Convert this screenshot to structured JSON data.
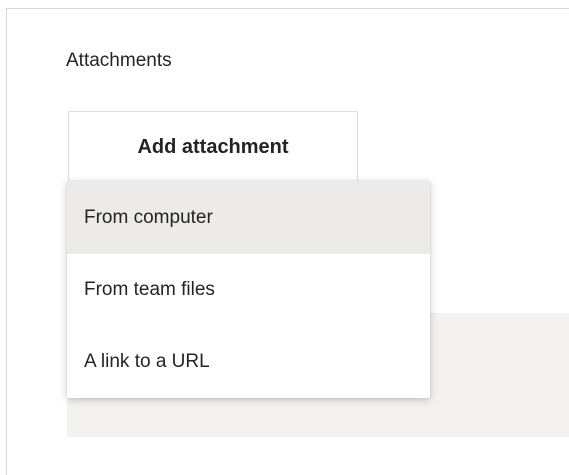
{
  "attachments": {
    "title": "Attachments",
    "add_button_label": "Add attachment",
    "menu": {
      "items": [
        {
          "label": "From computer",
          "state": "hovered"
        },
        {
          "label": "From team files",
          "state": "normal"
        },
        {
          "label": "A link to a URL",
          "state": "normal"
        }
      ]
    }
  },
  "colors": {
    "hover_background": "#edebe9",
    "text": "#252423",
    "panel_fill": "#f3f2f1"
  }
}
